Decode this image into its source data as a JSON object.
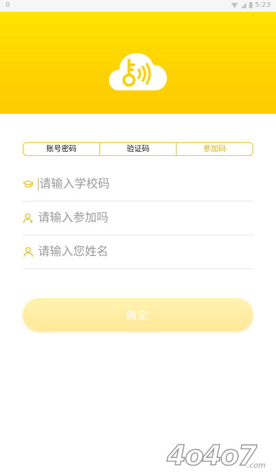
{
  "status_bar": {
    "left_indicator": "0",
    "time": "5:23"
  },
  "colors": {
    "accent": "#fdd100",
    "accent_text": "#e0b000",
    "button_bg": "#ffeea8",
    "divider": "#e4e4e4"
  },
  "logo": {
    "icon": "cloud-key-icon"
  },
  "login_tabs": [
    {
      "label": "账号密码"
    },
    {
      "label": "验证码"
    },
    {
      "label": "参加码"
    }
  ],
  "form": {
    "school_code": {
      "placeholder": "请输入学校码",
      "value": "",
      "icon": "graduation-cap-icon"
    },
    "join_code": {
      "placeholder": "请输入参加吗",
      "value": "",
      "icon": "user-add-icon"
    },
    "name": {
      "placeholder": "请输入您姓名",
      "value": "",
      "icon": "user-icon"
    }
  },
  "confirm_label": "确定",
  "watermark": {
    "text": "4o4o7",
    "suffix": ".com"
  }
}
